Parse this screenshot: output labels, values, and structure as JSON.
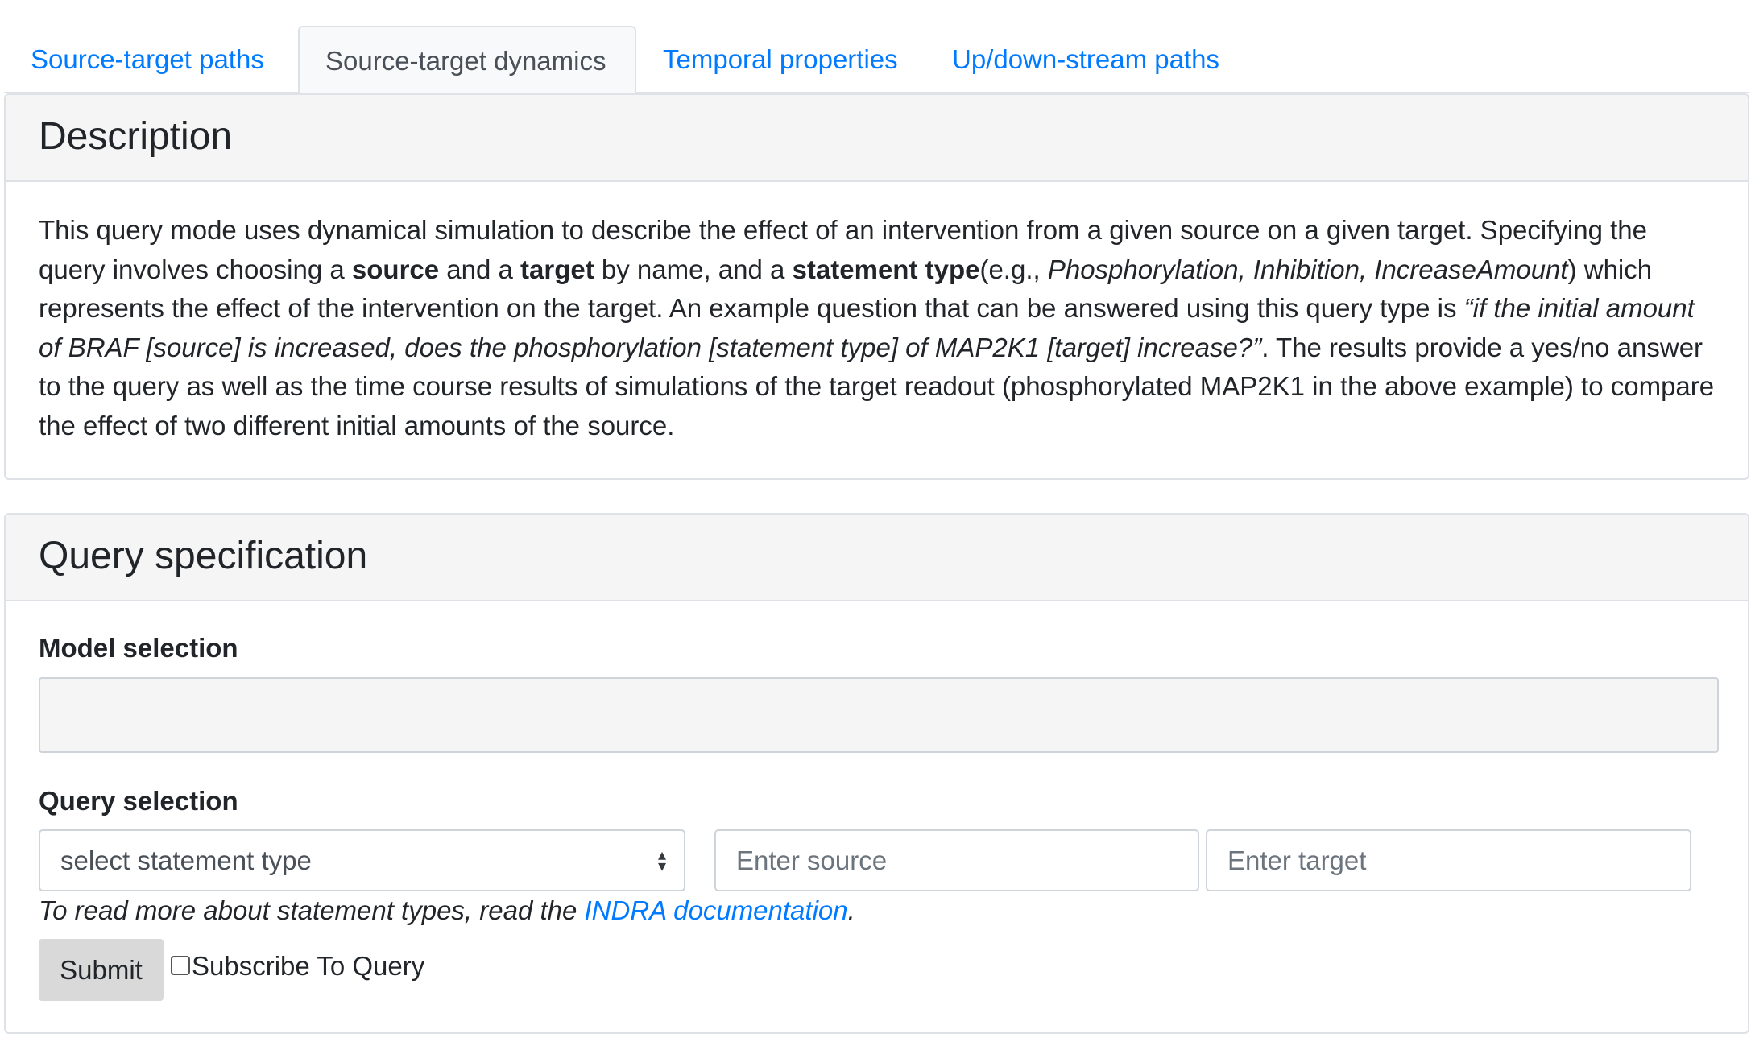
{
  "tabs": [
    {
      "label": "Source-target paths",
      "active": false
    },
    {
      "label": "Source-target dynamics",
      "active": true
    },
    {
      "label": "Temporal properties",
      "active": false
    },
    {
      "label": "Up/down-stream paths",
      "active": false
    }
  ],
  "description": {
    "title": "Description",
    "p1": "This query mode uses dynamical simulation to describe the effect of an intervention from a given source on a given target. Specifying the query involves choosing a ",
    "b_source": "source",
    "p2": " and a ",
    "b_target": "target",
    "p3": " by name, and a ",
    "b_stmt": "statement type",
    "p4": "(e.g., ",
    "i_examples": "Phosphorylation, Inhibition, IncreaseAmount",
    "p5": ") which represents the effect of the intervention on the target. An example question that can be answered using this query type is ",
    "i_question": "“if the initial amount of BRAF [source] is increased, does the phosphorylation [statement type] of MAP2K1 [target] increase?”",
    "p6": ". The results provide a yes/no answer to the query as well as the time course results of simulations of the target readout (phosphorylated MAP2K1 in the above example) to compare the effect of two different initial amounts of the source."
  },
  "query_spec": {
    "title": "Query specification",
    "model_label": "Model selection",
    "model_value": "",
    "query_label": "Query selection",
    "statement_select": "select statement type",
    "source_placeholder": "Enter source",
    "target_placeholder": "Enter target",
    "note_prefix": "To read more about statement types, read the ",
    "note_link": "INDRA documentation",
    "note_suffix": ".",
    "submit_label": "Submit",
    "subscribe_label": "Subscribe To Query",
    "subscribe_checked": false
  }
}
